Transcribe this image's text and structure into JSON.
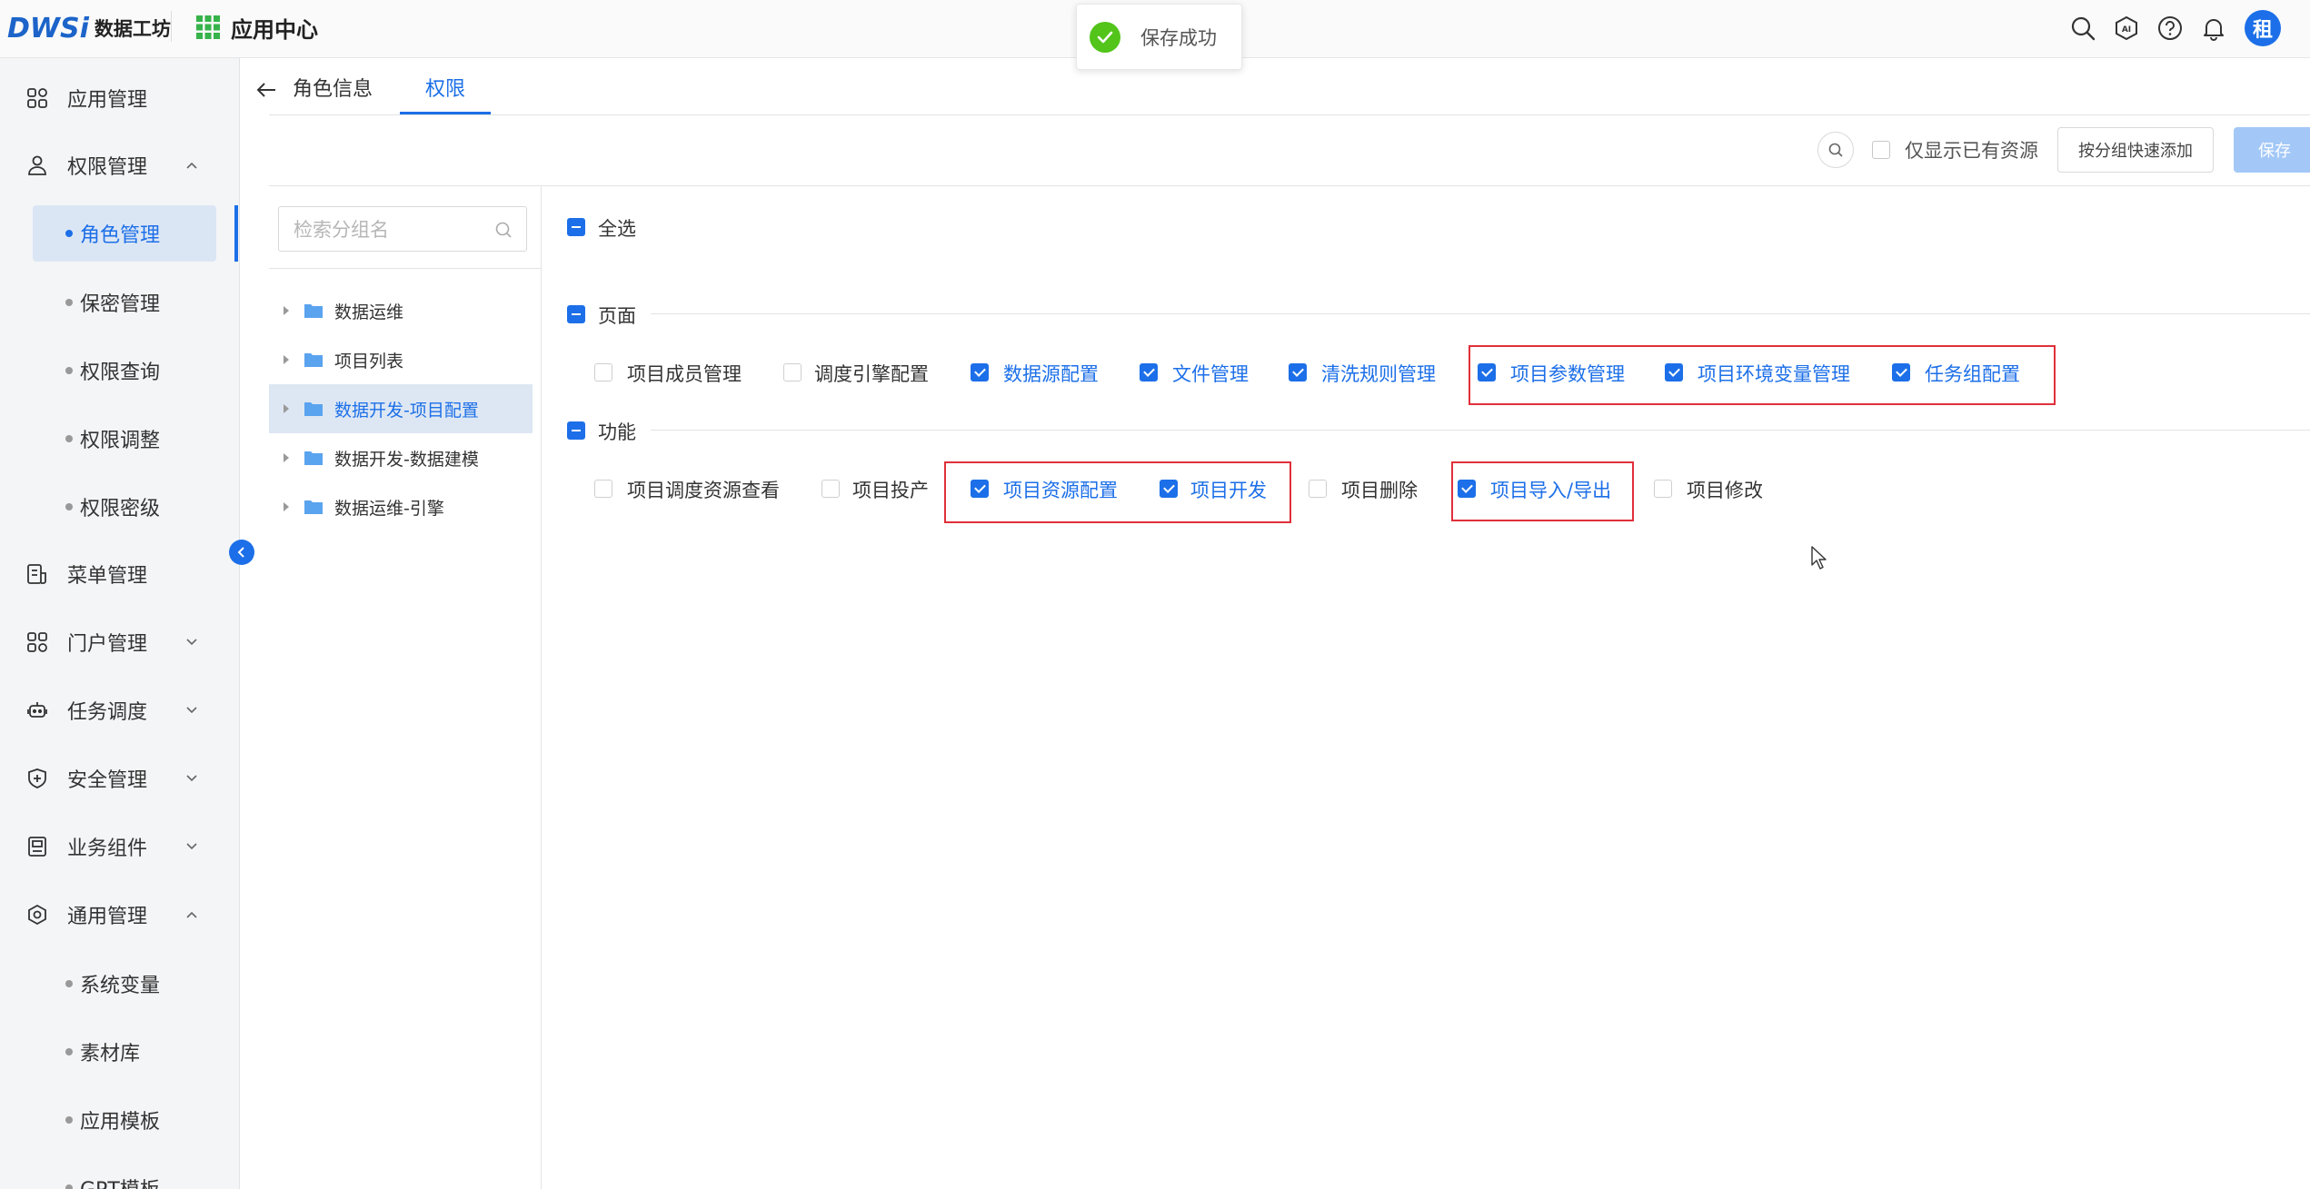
{
  "header": {
    "logo_mark_d": "D",
    "logo_mark_ws": "WS",
    "logo_mark_i": "i",
    "logo_sub": "数据工坊",
    "app_center_label": "应用中心",
    "avatar_text": "租",
    "icons": [
      "search-icon",
      "ai-icon",
      "help-icon",
      "bell-icon"
    ]
  },
  "toast": {
    "text": "保存成功",
    "color": "#52c41a"
  },
  "sidebar": {
    "items": [
      {
        "label": "应用管理",
        "icon": "app-grid-icon"
      },
      {
        "label": "权限管理",
        "icon": "user-lock-icon",
        "expanded": true
      },
      {
        "label": "角色管理",
        "sub": true,
        "active": true
      },
      {
        "label": "保密管理",
        "sub": true
      },
      {
        "label": "权限查询",
        "sub": true
      },
      {
        "label": "权限调整",
        "sub": true
      },
      {
        "label": "权限密级",
        "sub": true
      },
      {
        "label": "菜单管理",
        "icon": "menu-icon"
      },
      {
        "label": "门户管理",
        "icon": "portal-icon",
        "expanded": false
      },
      {
        "label": "任务调度",
        "icon": "robot-icon",
        "expanded": false
      },
      {
        "label": "安全管理",
        "icon": "shield-icon",
        "expanded": false
      },
      {
        "label": "业务组件",
        "icon": "component-icon",
        "expanded": false
      },
      {
        "label": "通用管理",
        "icon": "settings-icon",
        "expanded": true
      },
      {
        "label": "系统变量",
        "sub": true
      },
      {
        "label": "素材库",
        "sub": true
      },
      {
        "label": "应用模板",
        "sub": true
      },
      {
        "label": "GPT模板",
        "sub": true
      }
    ]
  },
  "tabs": {
    "role_info": "角色信息",
    "permission": "权限",
    "active": "permission"
  },
  "toolbar": {
    "only_existing_label": "仅显示已有资源",
    "only_existing_checked": false,
    "quick_add_label": "按分组快速添加",
    "save_label": "保存"
  },
  "tree": {
    "search_placeholder": "检索分组名",
    "nodes": [
      {
        "label": "数据运维",
        "selected": false
      },
      {
        "label": "项目列表",
        "selected": false
      },
      {
        "label": "数据开发-项目配置",
        "selected": true
      },
      {
        "label": "数据开发-数据建模",
        "selected": false
      },
      {
        "label": "数据运维-引擎",
        "selected": false
      }
    ]
  },
  "permissions": {
    "select_all": {
      "label": "全选",
      "state": "indeterminate"
    },
    "page_section": {
      "title": "页面",
      "state": "indeterminate",
      "items": [
        {
          "label": "项目成员管理",
          "checked": false
        },
        {
          "label": "调度引擎配置",
          "checked": false
        },
        {
          "label": "数据源配置",
          "checked": true
        },
        {
          "label": "文件管理",
          "checked": true
        },
        {
          "label": "清洗规则管理",
          "checked": true
        },
        {
          "label": "项目参数管理",
          "checked": true
        },
        {
          "label": "项目环境变量管理",
          "checked": true
        },
        {
          "label": "任务组配置",
          "checked": true
        }
      ]
    },
    "function_section": {
      "title": "功能",
      "state": "indeterminate",
      "items": [
        {
          "label": "项目调度资源查看",
          "checked": false
        },
        {
          "label": "项目投产",
          "checked": false
        },
        {
          "label": "项目资源配置",
          "checked": true
        },
        {
          "label": "项目开发",
          "checked": true
        },
        {
          "label": "项目删除",
          "checked": false
        },
        {
          "label": "项目导入/导出",
          "checked": true
        },
        {
          "label": "项目修改",
          "checked": false
        }
      ]
    }
  },
  "colors": {
    "accent": "#1c6fe8",
    "highlight_box": "#e0303a",
    "save_disabled": "#a3c8f7"
  }
}
